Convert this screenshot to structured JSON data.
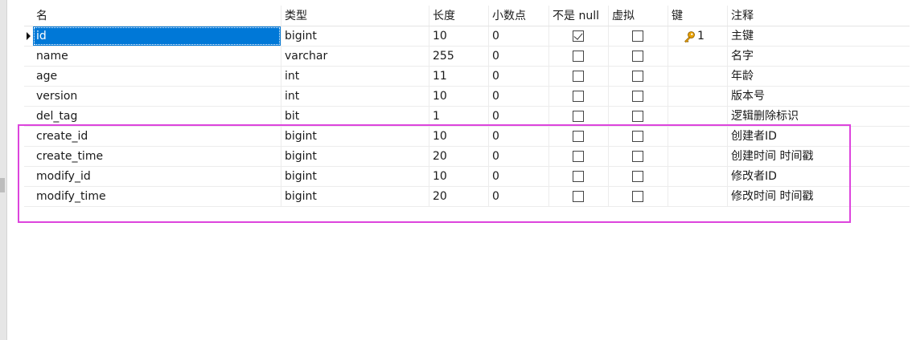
{
  "columns": [
    "名",
    "类型",
    "长度",
    "小数点",
    "不是 null",
    "虚拟",
    "键",
    "注释"
  ],
  "rows": [
    {
      "name": "id",
      "type": "bigint",
      "length": "10",
      "decimal": "0",
      "not_null": true,
      "virtual": false,
      "key": "1",
      "comment": "主键"
    },
    {
      "name": "name",
      "type": "varchar",
      "length": "255",
      "decimal": "0",
      "not_null": false,
      "virtual": false,
      "key": "",
      "comment": "名字"
    },
    {
      "name": "age",
      "type": "int",
      "length": "11",
      "decimal": "0",
      "not_null": false,
      "virtual": false,
      "key": "",
      "comment": "年龄"
    },
    {
      "name": "version",
      "type": "int",
      "length": "10",
      "decimal": "0",
      "not_null": false,
      "virtual": false,
      "key": "",
      "comment": "版本号"
    },
    {
      "name": "del_tag",
      "type": "bit",
      "length": "1",
      "decimal": "0",
      "not_null": false,
      "virtual": false,
      "key": "",
      "comment": "逻辑删除标识"
    },
    {
      "name": "create_id",
      "type": "bigint",
      "length": "10",
      "decimal": "0",
      "not_null": false,
      "virtual": false,
      "key": "",
      "comment": "创建者ID"
    },
    {
      "name": "create_time",
      "type": "bigint",
      "length": "20",
      "decimal": "0",
      "not_null": false,
      "virtual": false,
      "key": "",
      "comment": "创建时间 时间戳"
    },
    {
      "name": "modify_id",
      "type": "bigint",
      "length": "10",
      "decimal": "0",
      "not_null": false,
      "virtual": false,
      "key": "",
      "comment": "修改者ID"
    },
    {
      "name": "modify_time",
      "type": "bigint",
      "length": "20",
      "decimal": "0",
      "not_null": false,
      "virtual": false,
      "key": "",
      "comment": "修改时间 时间戳"
    }
  ],
  "colors": {
    "selection": "#0078d7",
    "highlight_box": "#dd44dd",
    "key_icon": "#e8a000"
  },
  "icons": {
    "key": "key-icon",
    "row_marker": "current-row-arrow-icon"
  }
}
